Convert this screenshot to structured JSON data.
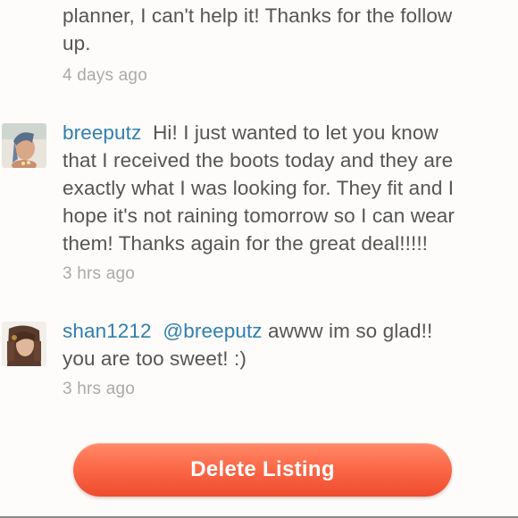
{
  "comments": [
    {
      "username": "",
      "text_lines": [
        "planner, I can't help it! Thanks for the follow",
        "up."
      ],
      "timestamp": "4 days ago"
    },
    {
      "username": "breeputz",
      "text_lines": [
        "Hi! I just wanted to let you know",
        "that I received the boots today and they are",
        "exactly what I was looking for. They fit and I",
        "hope it's not raining tomorrow so I can wear",
        "them! Thanks again for the great deal!!!!!"
      ],
      "timestamp": "3 hrs ago"
    },
    {
      "username": "shan1212",
      "mention": "@breeputz",
      "text_lines": [
        "awww im so glad!!",
        "you are too sweet! :)"
      ],
      "timestamp": "3 hrs ago"
    }
  ],
  "actions": {
    "delete_label": "Delete Listing"
  },
  "colors": {
    "username": "#2f7fb0",
    "timestamp": "#aaaaaa",
    "body_text": "#555555",
    "delete_button": "#fb6a49"
  },
  "icons": {
    "avatar_breeputz": "avatar-photo",
    "avatar_shan1212": "avatar-photo"
  }
}
